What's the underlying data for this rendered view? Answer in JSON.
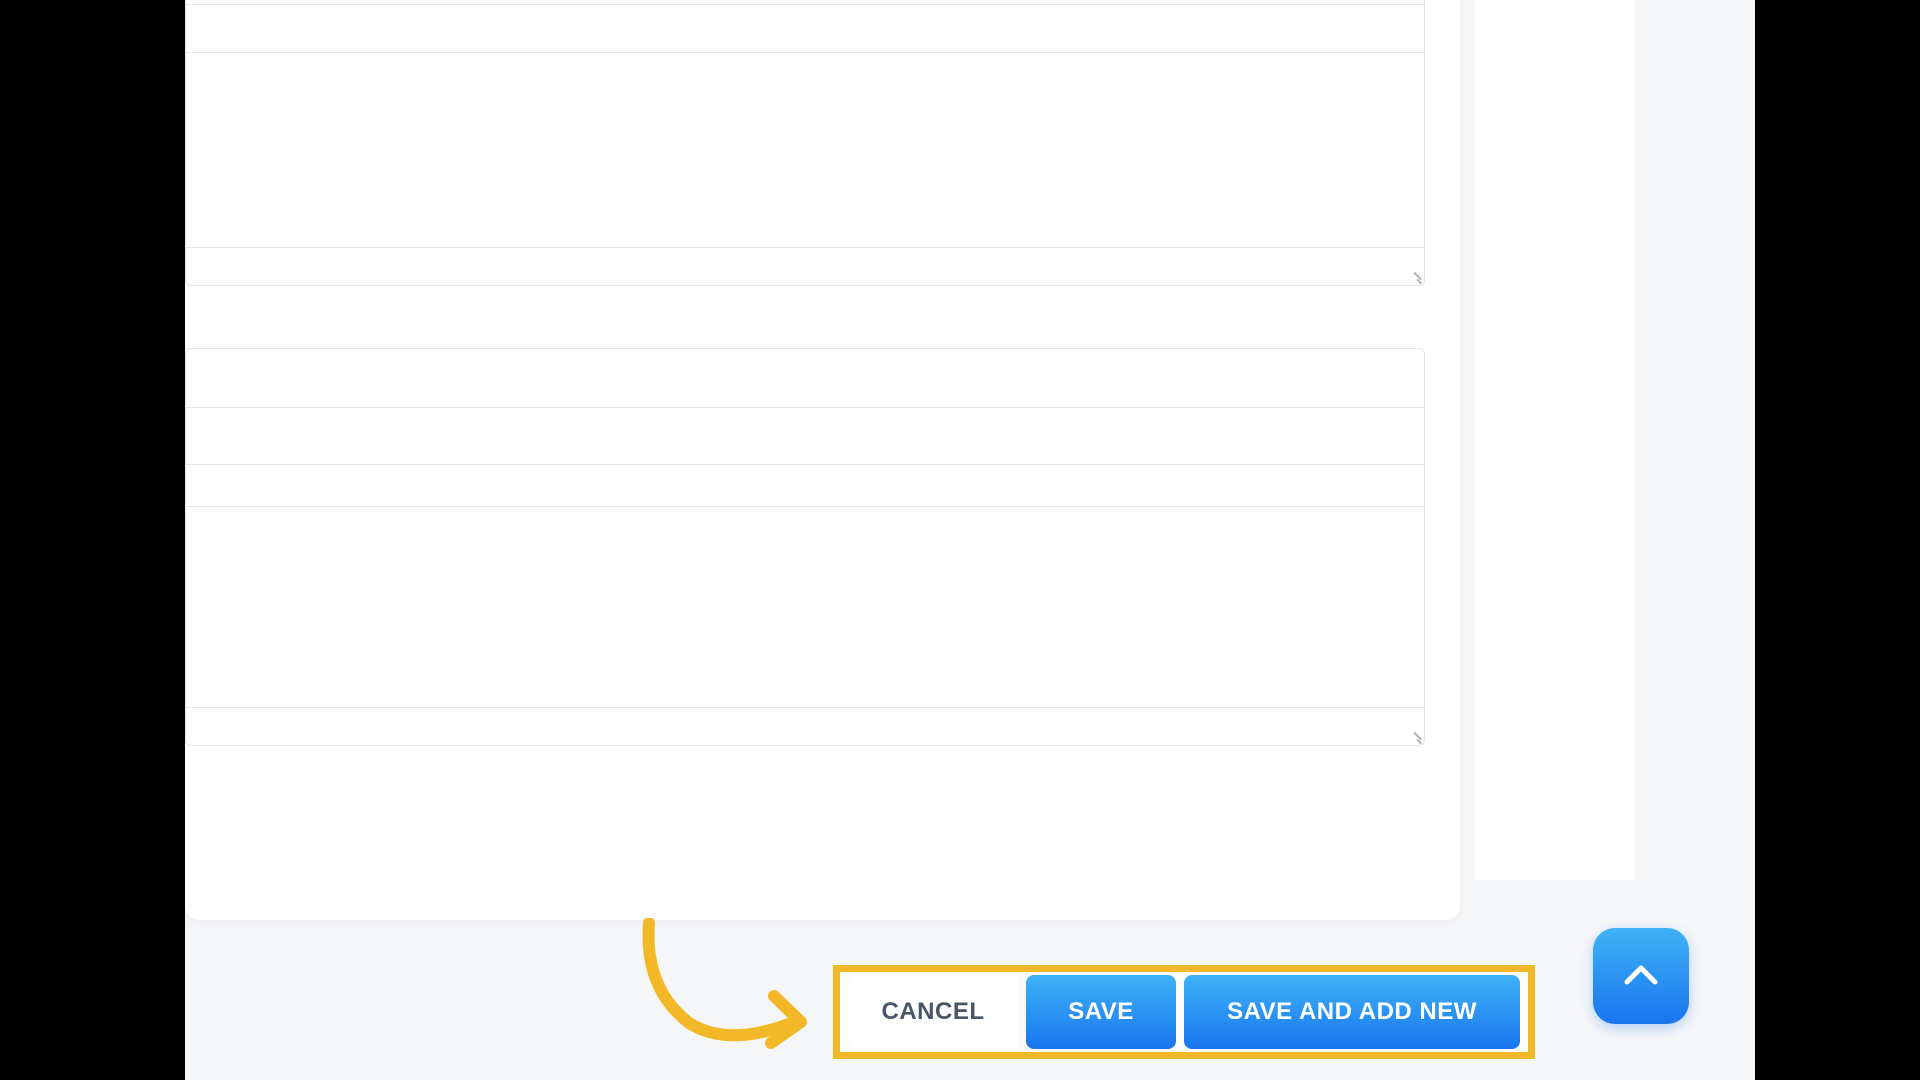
{
  "actions": {
    "cancel_label": "CANCEL",
    "save_label": "SAVE",
    "save_and_add_new_label": "SAVE AND ADD NEW"
  },
  "colors": {
    "highlight": "#f2b827",
    "primary_gradient_start": "#3fb2f7",
    "primary_gradient_end": "#1876ee"
  }
}
